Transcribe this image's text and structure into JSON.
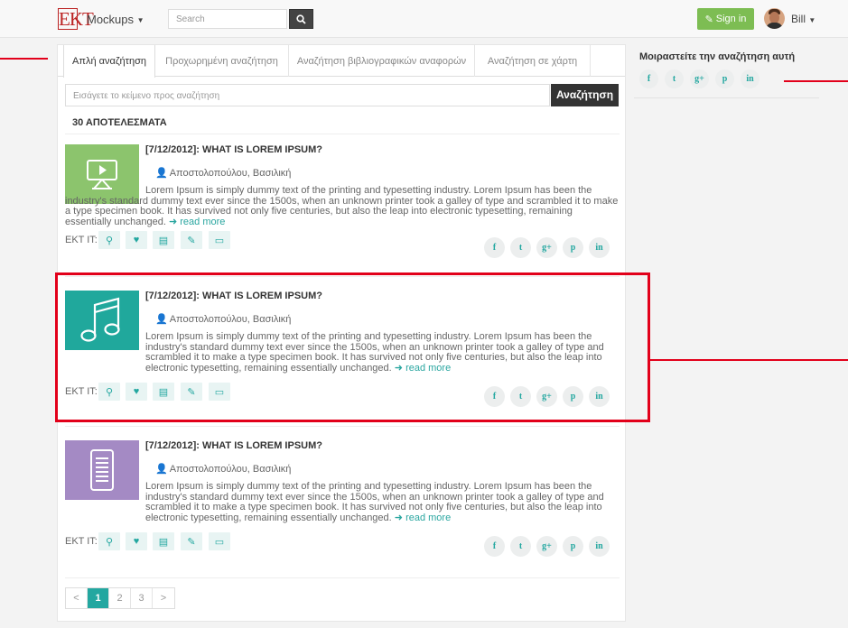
{
  "topbar": {
    "logo": "EKT",
    "brand": "Mockups",
    "search_placeholder": "Search",
    "signin_label": "Sign in",
    "user_name": "Bill"
  },
  "tabs": [
    {
      "label": "Απλή αναζήτηση"
    },
    {
      "label": "Προχωρημένη αναζήτηση"
    },
    {
      "label": "Αναζήτηση βιβλιογραφικών αναφορών"
    },
    {
      "label": "Αναζήτηση σε χάρτη"
    }
  ],
  "query": {
    "placeholder": "Εισάγετε το κείμενο προς αναζήτηση",
    "button": "Αναζήτηση"
  },
  "results_count": "30 ΑΠΟΤΕΛΕΣΜΑΤΑ",
  "results": [
    {
      "title": "[7/12/2012]: WHAT IS LOREM IPSUM?",
      "author": "Αποστολοπούλου, Βασιλική",
      "body": "Lorem Ipsum is simply dummy text of the printing and typesetting industry. Lorem Ipsum has been the industry's standard dummy text ever since the 1500s, when an unknown printer took a galley of type and scrambled it to make a type specimen book. It has survived not only five centuries, but also the leap into electronic typesetting, remaining essentially unchanged.",
      "read_more": "read more",
      "thumb_color": "#8cc46d",
      "thumb_icon": "video-icon"
    },
    {
      "title": "[7/12/2012]: WHAT IS LOREM IPSUM?",
      "author": "Αποστολοπούλου, Βασιλική",
      "body": "Lorem Ipsum is simply dummy text of the printing and typesetting industry. Lorem Ipsum has been the industry's standard dummy text ever since the 1500s, when an unknown printer took a galley of type and scrambled it to make a type specimen book. It has survived not only five centuries, but also the leap into electronic typesetting, remaining essentially unchanged.",
      "read_more": "read more",
      "thumb_color": "#20a89c",
      "thumb_icon": "music-icon"
    },
    {
      "title": "[7/12/2012]: WHAT IS LOREM IPSUM?",
      "author": "Αποστολοπούλου, Βασιλική",
      "body": "Lorem Ipsum is simply dummy text of the printing and typesetting industry. Lorem Ipsum has been the industry's standard dummy text ever since the 1500s, when an unknown printer took a galley of type and scrambled it to make a type specimen book. It has survived not only five centuries, but also the leap into electronic typesetting, remaining essentially unchanged.",
      "read_more": "read more",
      "thumb_color": "#a48ac4",
      "thumb_icon": "document-icon"
    }
  ],
  "ekt_label": "EKT IT:",
  "pagination": {
    "prev": "<",
    "pages": [
      "1",
      "2",
      "3"
    ],
    "next": ">",
    "current": "1"
  },
  "sidebar": {
    "title": "Μοιραστείτε την αναζήτηση αυτή"
  },
  "share_icons": [
    "facebook-icon",
    "twitter-icon",
    "google-plus-icon",
    "pinterest-icon",
    "linkedin-icon"
  ],
  "share_glyphs": [
    "f",
    "t",
    "g+",
    "p",
    "in"
  ],
  "colors": {
    "accent": "#23a7a0",
    "signin": "#7dbd53",
    "annotation": "#e2001a"
  }
}
